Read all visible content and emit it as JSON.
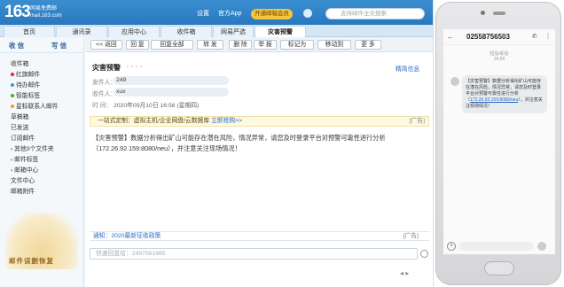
{
  "header": {
    "logo": "163",
    "logo_sub_1": "网易免费邮",
    "logo_sub_2": "mail.163.com",
    "links": [
      "设置",
      "官方App",
      "开通邮箱会员"
    ],
    "search_placeholder": "支持邮件全文搜索"
  },
  "tabs": [
    "首页",
    "通讯录",
    "应用中心",
    "收件箱",
    "网易严选",
    "灾害预警"
  ],
  "sidebar": {
    "receive": "收 信",
    "write": "写 信",
    "folders": [
      "收件箱",
      "红旗邮件",
      "待办邮件",
      "智能标签",
      "星标联系人邮件",
      "草稿箱",
      "已发送",
      "订阅邮件",
      "其他3个文件夹",
      "邮件标签",
      "邮箱中心",
      "文件中心",
      "邮箱附件"
    ],
    "promo": "邮件误删恢复"
  },
  "toolbar": [
    "<< 返回",
    "回 复",
    "回复全部",
    "转 发",
    "删 除",
    "举 报",
    "标记为",
    "移动到",
    "更 多"
  ],
  "mail": {
    "subject": "灾害预警",
    "quick_reply": "精简信息",
    "sender_label": "发件人：",
    "sender": "249",
    "recipient_label": "收件人：",
    "recipient": "xux",
    "time_label": "时  间：",
    "time": "2020年09月10日 16:56 (星期四)",
    "banner": "一站式定制：虚拟主机/企业网盘/云数据库",
    "banner_link": "立即抢购>>",
    "banner_ad": "[广告]",
    "body": "【灾害预警】数据分析得出矿山可能存在潜在风险，情况异常，请您及时登录平台对预警可靠性进行分析（172.26.92.159:8080/neu），并注意关注现场情况！",
    "notice": "通知：2020最新征收政策",
    "notice_ad": "[广告]",
    "reply_placeholder": "快速回复给：2497561965"
  },
  "phone": {
    "number": "02558756503",
    "meta_1": "短信/彩信",
    "meta_2": "16:56",
    "bubble_pre": "【灾害预警】数据分析得出矿山可能存在潜在风险，情况异常，请您及时登录平台对预警可靠性进行分析（",
    "bubble_link": "172.26.92.159:8080/neu",
    "bubble_post": "），并注意关注现场情况！"
  }
}
